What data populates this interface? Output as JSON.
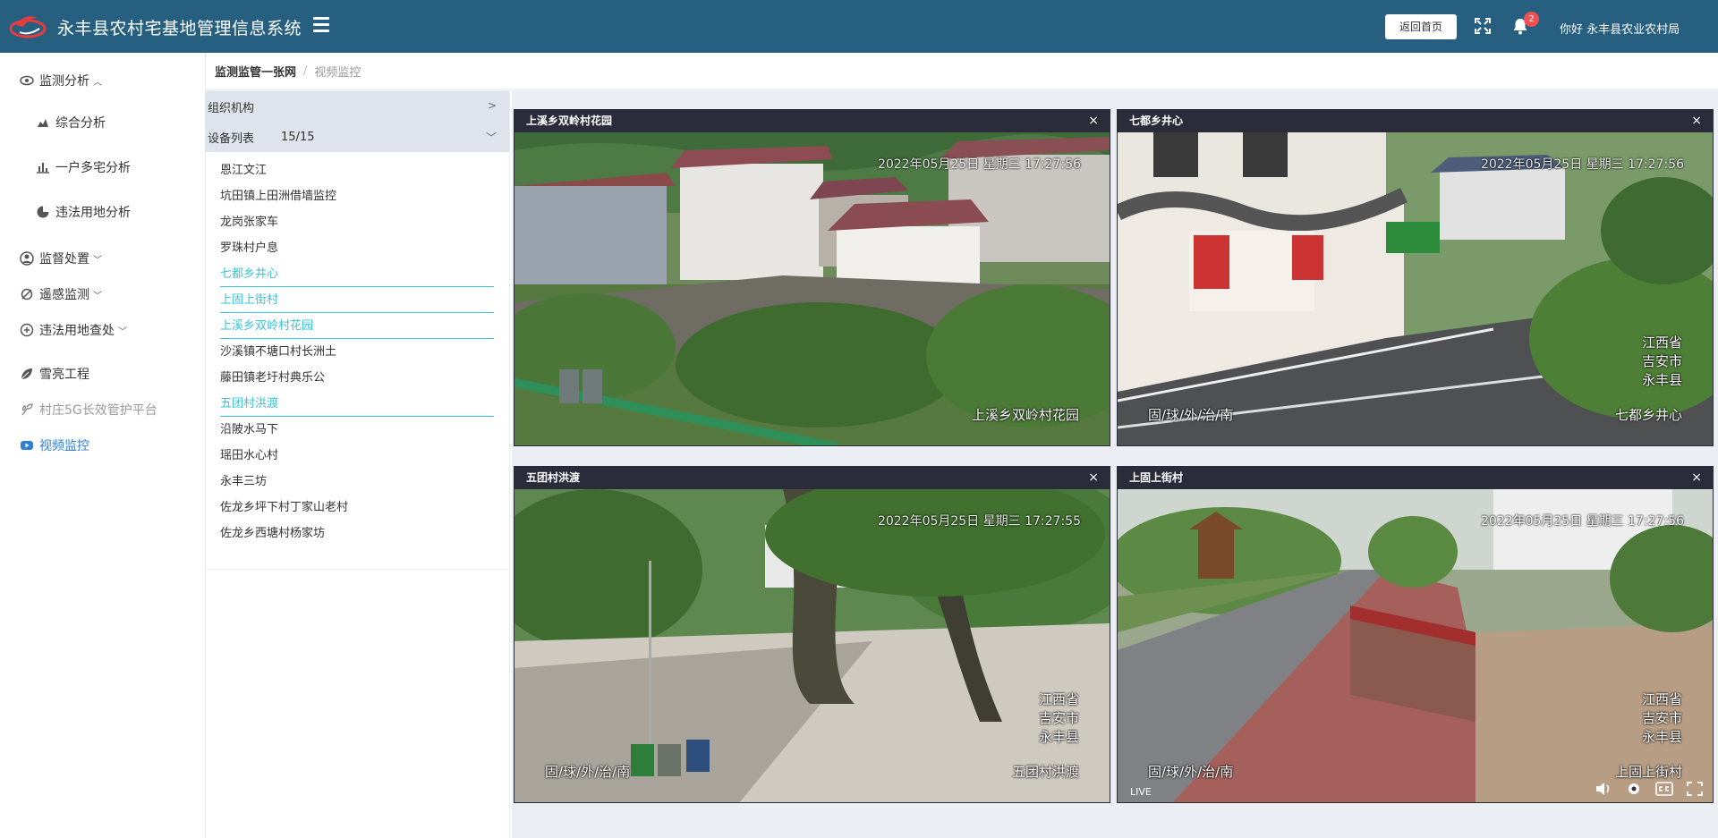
{
  "header": {
    "title": "永丰县农村宅基地管理信息系统",
    "home_label": "返回首页",
    "notification_count": "2",
    "greeting": "你好 永丰县农业农村局"
  },
  "sidebar": {
    "items": [
      {
        "label": "监测分析",
        "icon": "eye-icon"
      },
      {
        "label": "综合分析",
        "icon": "area-chart-icon"
      },
      {
        "label": "一户多宅分析",
        "icon": "bar-chart-icon"
      },
      {
        "label": "违法用地分析",
        "icon": "pie-chart-icon"
      },
      {
        "label": "监督处置",
        "icon": "user-icon"
      },
      {
        "label": "遥感监测",
        "icon": "satellite-icon"
      },
      {
        "label": "违法用地查处",
        "icon": "search-icon"
      },
      {
        "label": "雪亮工程",
        "icon": "leaf-icon"
      },
      {
        "label": "村庄5G长效管护平台",
        "icon": "plant-icon"
      },
      {
        "label": "视频监控",
        "icon": "video-icon"
      }
    ]
  },
  "breadcrumb": {
    "current": "监测监管一张网",
    "separator": "/",
    "last": "视频监控"
  },
  "device_panel": {
    "org_label": "组织机构",
    "list_label": "设备列表",
    "list_count": "15/15",
    "devices": [
      {
        "name": "恩江文江",
        "online": false
      },
      {
        "name": "坑田镇上田洲借墙监控",
        "online": false
      },
      {
        "name": "龙岗张家车",
        "online": false
      },
      {
        "name": "罗珠村户息",
        "online": false
      },
      {
        "name": "七都乡井心",
        "online": true
      },
      {
        "name": "上固上街村",
        "online": true
      },
      {
        "name": "上溪乡双岭村花园",
        "online": true
      },
      {
        "name": "沙溪镇不塘口村长洲土",
        "online": false
      },
      {
        "name": "藤田镇老圩村典乐公",
        "online": false
      },
      {
        "name": "五团村洪渡",
        "online": true
      },
      {
        "name": "沿陂水马下",
        "online": false
      },
      {
        "name": "瑶田水心村",
        "online": false
      },
      {
        "name": "永丰三坊",
        "online": false
      },
      {
        "name": "佐龙乡坪下村丁家山老村",
        "online": false
      },
      {
        "name": "佐龙乡西塘村杨家坊",
        "online": false
      }
    ]
  },
  "videos": [
    {
      "title": "上溪乡双岭村花园",
      "timestamp": "2022年05月25日 星期三 17:27:56",
      "bottom_left": "",
      "bottom_right": "上溪乡双岭村花园",
      "region": [
        "",
        "",
        ""
      ],
      "scene": "village"
    },
    {
      "title": "七都乡井心",
      "timestamp": "2022年05月25日 星期三 17:27:56",
      "bottom_left": "固/球/外/治/南",
      "bottom_right": "七都乡井心",
      "region": [
        "江西省",
        "吉安市",
        "永丰县"
      ],
      "scene": "road"
    },
    {
      "title": "五团村洪渡",
      "timestamp": "2022年05月25日 星期三 17:27:55",
      "bottom_left": "固/球/外/治/南",
      "bottom_right": "五团村洪渡",
      "region": [
        "江西省",
        "吉安市",
        "永丰县"
      ],
      "scene": "square"
    },
    {
      "title": "上固上街村",
      "timestamp": "2022年05月25日 星期三 17:27:56",
      "bottom_left": "固/球/外/治/南",
      "bottom_right": "上固上街村",
      "region": [
        "江西省",
        "吉安市",
        "永丰县"
      ],
      "scene": "path"
    }
  ],
  "player": {
    "live_label": "LIVE"
  },
  "colors": {
    "header_bg": "#265f80",
    "active": "#2e7fd6",
    "online": "#3bc4d5",
    "badge": "#f05050"
  }
}
